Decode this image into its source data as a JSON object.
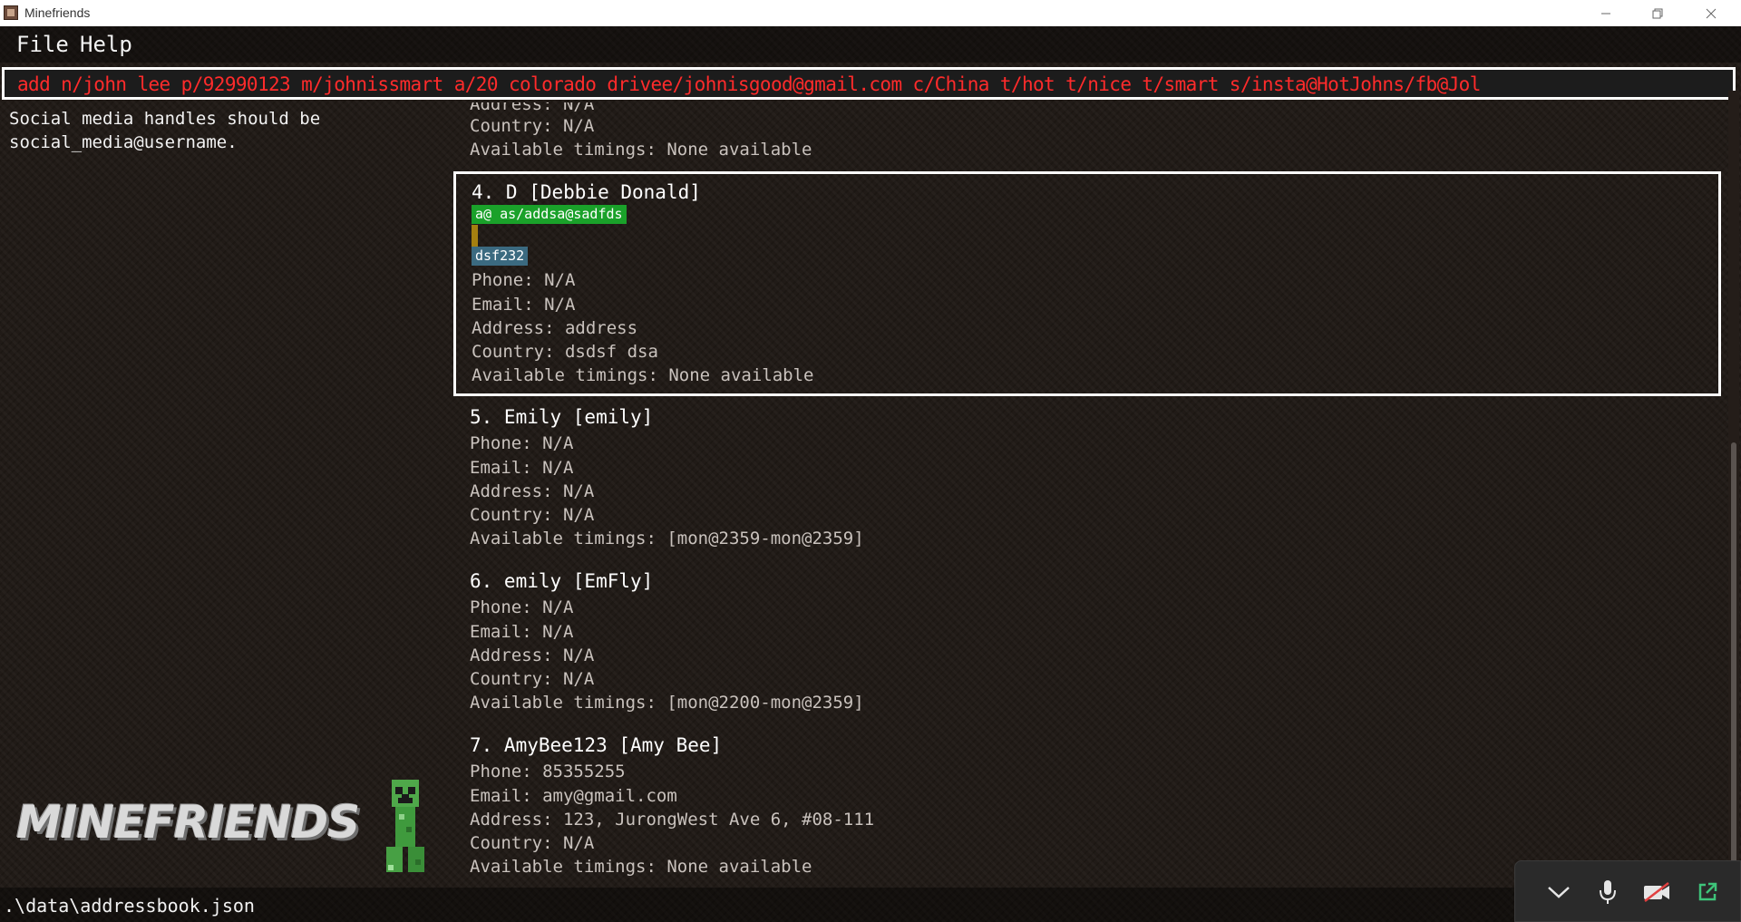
{
  "window": {
    "title": "Minefriends"
  },
  "menu": {
    "file": "File",
    "help": "Help"
  },
  "command": {
    "value": "add n/john lee p/92990123 m/johnissmart a/20 colorado drivee/johnisgood@gmail.com c/China t/hot t/nice t/smart s/insta@HotJohns/fb@Jol"
  },
  "result": {
    "text": "Social media handles should be\nsocial_media@username."
  },
  "partial_card": {
    "address": "Address: N/A",
    "country": "Country: N/A",
    "timings": "Available timings: None available"
  },
  "persons": [
    {
      "title": "4. D [Debbie Donald]",
      "social_tag": "a@ as/addsa@sadfds",
      "tag": "dsf232",
      "phone": "Phone: N/A",
      "email": "Email: N/A",
      "address": "Address: address",
      "country": "Country: dsdsf dsa",
      "timings": "Available timings: None available"
    },
    {
      "title": "5. Emily [emily]",
      "phone": "Phone: N/A",
      "email": "Email: N/A",
      "address": "Address: N/A",
      "country": "Country: N/A",
      "timings": "Available timings: [mon@2359-mon@2359]"
    },
    {
      "title": "6. emily [EmFly]",
      "phone": "Phone: N/A",
      "email": "Email: N/A",
      "address": "Address: N/A",
      "country": "Country: N/A",
      "timings": "Available timings: [mon@2200-mon@2359]"
    },
    {
      "title": "7. AmyBee123 [Amy Bee]",
      "phone": "Phone: 85355255",
      "email": "Email: amy@gmail.com",
      "address": "Address: 123, JurongWest Ave 6, #08-111",
      "country": "Country: N/A",
      "timings": "Available timings: None available"
    }
  ],
  "logo": {
    "text": "MINEFRIENDS"
  },
  "status": {
    "path": ".\\data\\addressbook.json"
  },
  "colors": {
    "command_text": "#ff2b2b",
    "social_tag": "#1aa12a",
    "plain_tag": "#3b6a80"
  },
  "icons": [
    "chevron-down-icon",
    "microphone-icon",
    "camera-off-icon",
    "pop-out-icon"
  ]
}
